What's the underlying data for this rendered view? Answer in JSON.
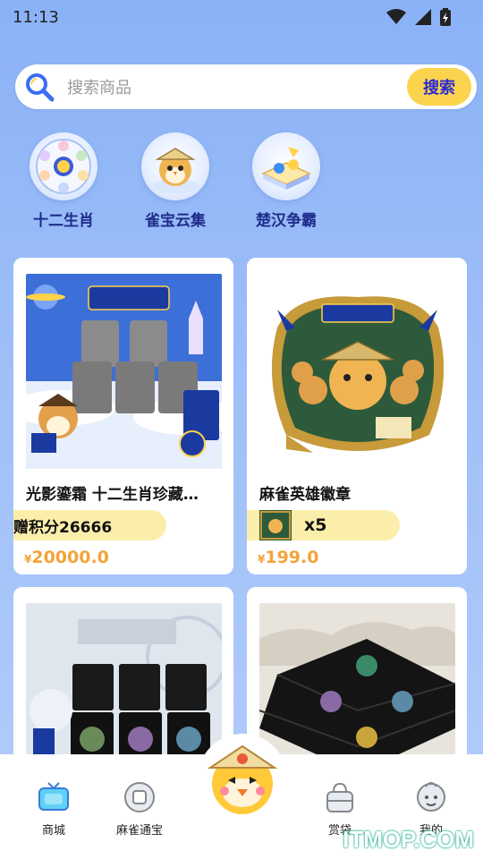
{
  "status_bar": {
    "time": "11:13"
  },
  "search": {
    "placeholder": "搜索商品",
    "button_label": "搜索"
  },
  "categories": [
    {
      "label": "十二生肖",
      "icon": "zodiac-wheel-icon"
    },
    {
      "label": "雀宝云集",
      "icon": "bird-mascot-icon"
    },
    {
      "label": "楚汉争霸",
      "icon": "battle-board-icon"
    }
  ],
  "products": [
    {
      "title": "光影鎏霜 十二生肖珍藏…",
      "pill_text": "赠积分26666",
      "price": "20000.0",
      "currency": "¥",
      "image": "zodiac-gift-box"
    },
    {
      "title": "麻雀英雄徽章",
      "pill_text": "x5",
      "price": "199.0",
      "currency": "¥",
      "image": "hero-badge"
    },
    {
      "title": "",
      "image": "six-gift-box"
    },
    {
      "title": "",
      "image": "black-boxes"
    }
  ],
  "nav": {
    "items": [
      {
        "label": "商城",
        "icon": "tv-icon"
      },
      {
        "label": "麻雀通宝",
        "icon": "coin-icon"
      },
      {
        "label": "赏袋",
        "icon": "bag-icon"
      },
      {
        "label": "我的",
        "icon": "profile-icon"
      }
    ],
    "center_icon": "mascot-icon"
  },
  "watermark": "ITMOP.COM",
  "colors": {
    "accent_yellow": "#fbd34d",
    "accent_blue": "#2b2bd0",
    "price_orange": "#f3a33b",
    "pill_bg": "#fbeeaa"
  }
}
